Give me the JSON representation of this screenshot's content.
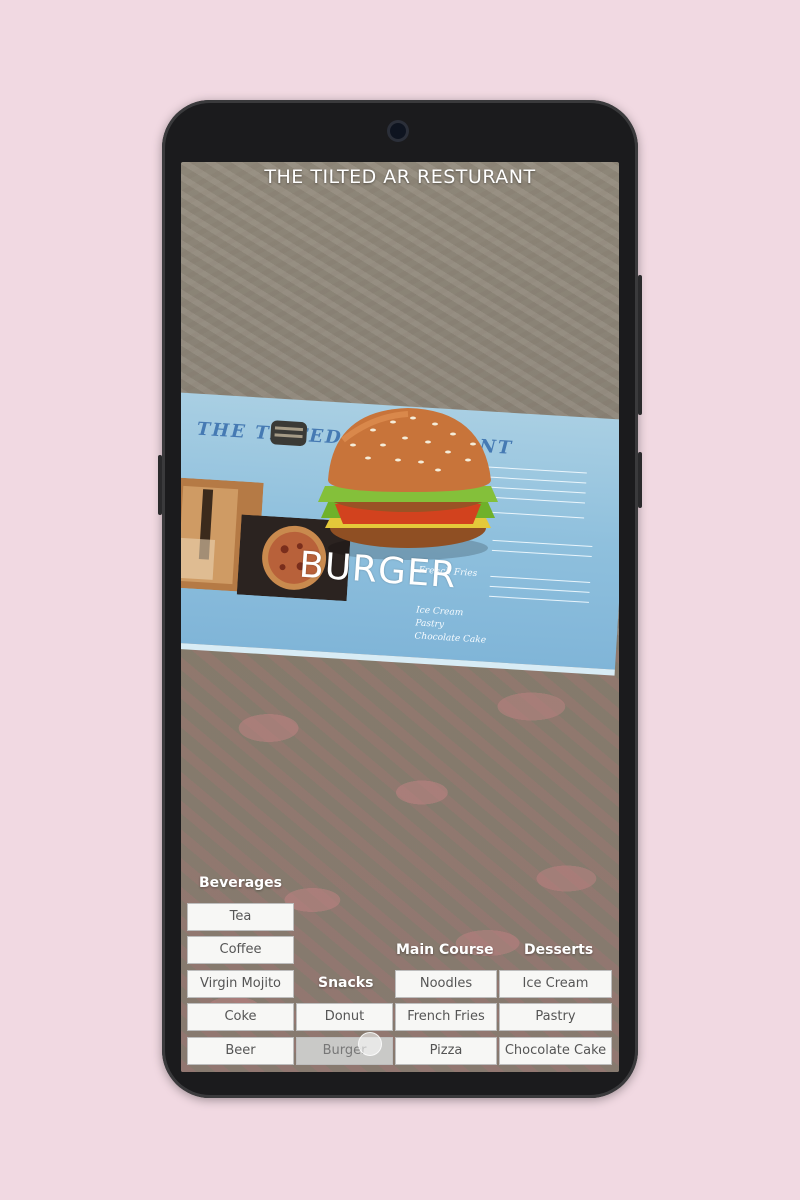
{
  "app": {
    "title": "THE TILTED AR RESTURANT"
  },
  "ar_label": "BURGER",
  "menu_card": {
    "heading": "THE TILTED RESTAURANT",
    "visible_items": [
      "French Fries",
      "Ice Cream",
      "Pastry",
      "Chocolate Cake"
    ]
  },
  "sections": {
    "beverages": {
      "label": "Beverages",
      "items": [
        "Tea",
        "Coffee",
        "Virgin Mojito",
        "Coke",
        "Beer"
      ]
    },
    "snacks": {
      "label": "Snacks",
      "items": [
        "Donut",
        "Burger"
      ]
    },
    "main_course": {
      "label": "Main Course",
      "items": [
        "Noodles",
        "French Fries",
        "Pizza"
      ]
    },
    "desserts": {
      "label": "Desserts",
      "items": [
        "Ice Cream",
        "Pastry",
        "Chocolate Cake"
      ]
    }
  },
  "selected_item": "Burger",
  "colors": {
    "background": "#f1d9e2",
    "phone_body": "#1b1b1d",
    "button_bg": "#f7f7f5",
    "selected_button_bg": "#c9c9c7"
  }
}
